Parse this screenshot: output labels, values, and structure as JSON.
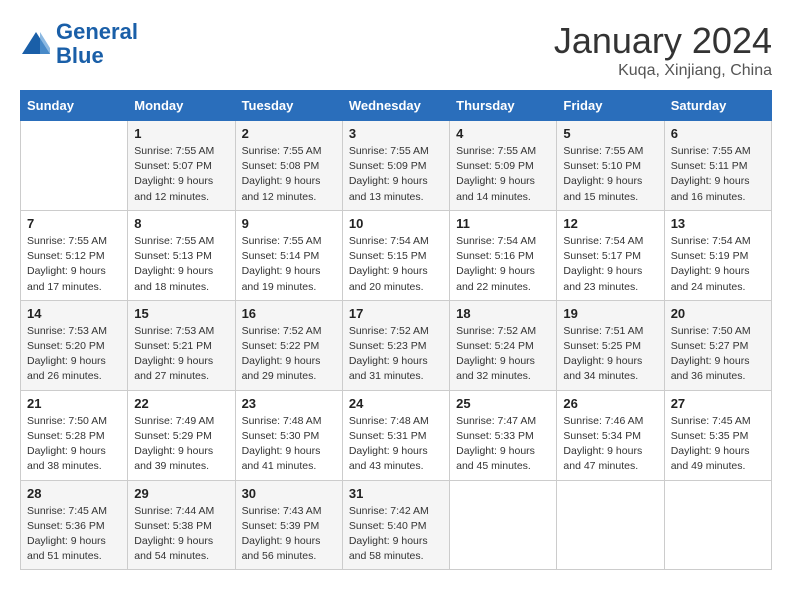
{
  "header": {
    "logo_general": "General",
    "logo_blue": "Blue",
    "month_title": "January 2024",
    "location": "Kuqa, Xinjiang, China"
  },
  "days_of_week": [
    "Sunday",
    "Monday",
    "Tuesday",
    "Wednesday",
    "Thursday",
    "Friday",
    "Saturday"
  ],
  "weeks": [
    [
      {
        "num": "",
        "info": ""
      },
      {
        "num": "1",
        "info": "Sunrise: 7:55 AM\nSunset: 5:07 PM\nDaylight: 9 hours\nand 12 minutes."
      },
      {
        "num": "2",
        "info": "Sunrise: 7:55 AM\nSunset: 5:08 PM\nDaylight: 9 hours\nand 12 minutes."
      },
      {
        "num": "3",
        "info": "Sunrise: 7:55 AM\nSunset: 5:09 PM\nDaylight: 9 hours\nand 13 minutes."
      },
      {
        "num": "4",
        "info": "Sunrise: 7:55 AM\nSunset: 5:09 PM\nDaylight: 9 hours\nand 14 minutes."
      },
      {
        "num": "5",
        "info": "Sunrise: 7:55 AM\nSunset: 5:10 PM\nDaylight: 9 hours\nand 15 minutes."
      },
      {
        "num": "6",
        "info": "Sunrise: 7:55 AM\nSunset: 5:11 PM\nDaylight: 9 hours\nand 16 minutes."
      }
    ],
    [
      {
        "num": "7",
        "info": "Sunrise: 7:55 AM\nSunset: 5:12 PM\nDaylight: 9 hours\nand 17 minutes."
      },
      {
        "num": "8",
        "info": "Sunrise: 7:55 AM\nSunset: 5:13 PM\nDaylight: 9 hours\nand 18 minutes."
      },
      {
        "num": "9",
        "info": "Sunrise: 7:55 AM\nSunset: 5:14 PM\nDaylight: 9 hours\nand 19 minutes."
      },
      {
        "num": "10",
        "info": "Sunrise: 7:54 AM\nSunset: 5:15 PM\nDaylight: 9 hours\nand 20 minutes."
      },
      {
        "num": "11",
        "info": "Sunrise: 7:54 AM\nSunset: 5:16 PM\nDaylight: 9 hours\nand 22 minutes."
      },
      {
        "num": "12",
        "info": "Sunrise: 7:54 AM\nSunset: 5:17 PM\nDaylight: 9 hours\nand 23 minutes."
      },
      {
        "num": "13",
        "info": "Sunrise: 7:54 AM\nSunset: 5:19 PM\nDaylight: 9 hours\nand 24 minutes."
      }
    ],
    [
      {
        "num": "14",
        "info": "Sunrise: 7:53 AM\nSunset: 5:20 PM\nDaylight: 9 hours\nand 26 minutes."
      },
      {
        "num": "15",
        "info": "Sunrise: 7:53 AM\nSunset: 5:21 PM\nDaylight: 9 hours\nand 27 minutes."
      },
      {
        "num": "16",
        "info": "Sunrise: 7:52 AM\nSunset: 5:22 PM\nDaylight: 9 hours\nand 29 minutes."
      },
      {
        "num": "17",
        "info": "Sunrise: 7:52 AM\nSunset: 5:23 PM\nDaylight: 9 hours\nand 31 minutes."
      },
      {
        "num": "18",
        "info": "Sunrise: 7:52 AM\nSunset: 5:24 PM\nDaylight: 9 hours\nand 32 minutes."
      },
      {
        "num": "19",
        "info": "Sunrise: 7:51 AM\nSunset: 5:25 PM\nDaylight: 9 hours\nand 34 minutes."
      },
      {
        "num": "20",
        "info": "Sunrise: 7:50 AM\nSunset: 5:27 PM\nDaylight: 9 hours\nand 36 minutes."
      }
    ],
    [
      {
        "num": "21",
        "info": "Sunrise: 7:50 AM\nSunset: 5:28 PM\nDaylight: 9 hours\nand 38 minutes."
      },
      {
        "num": "22",
        "info": "Sunrise: 7:49 AM\nSunset: 5:29 PM\nDaylight: 9 hours\nand 39 minutes."
      },
      {
        "num": "23",
        "info": "Sunrise: 7:48 AM\nSunset: 5:30 PM\nDaylight: 9 hours\nand 41 minutes."
      },
      {
        "num": "24",
        "info": "Sunrise: 7:48 AM\nSunset: 5:31 PM\nDaylight: 9 hours\nand 43 minutes."
      },
      {
        "num": "25",
        "info": "Sunrise: 7:47 AM\nSunset: 5:33 PM\nDaylight: 9 hours\nand 45 minutes."
      },
      {
        "num": "26",
        "info": "Sunrise: 7:46 AM\nSunset: 5:34 PM\nDaylight: 9 hours\nand 47 minutes."
      },
      {
        "num": "27",
        "info": "Sunrise: 7:45 AM\nSunset: 5:35 PM\nDaylight: 9 hours\nand 49 minutes."
      }
    ],
    [
      {
        "num": "28",
        "info": "Sunrise: 7:45 AM\nSunset: 5:36 PM\nDaylight: 9 hours\nand 51 minutes."
      },
      {
        "num": "29",
        "info": "Sunrise: 7:44 AM\nSunset: 5:38 PM\nDaylight: 9 hours\nand 54 minutes."
      },
      {
        "num": "30",
        "info": "Sunrise: 7:43 AM\nSunset: 5:39 PM\nDaylight: 9 hours\nand 56 minutes."
      },
      {
        "num": "31",
        "info": "Sunrise: 7:42 AM\nSunset: 5:40 PM\nDaylight: 9 hours\nand 58 minutes."
      },
      {
        "num": "",
        "info": ""
      },
      {
        "num": "",
        "info": ""
      },
      {
        "num": "",
        "info": ""
      }
    ]
  ]
}
